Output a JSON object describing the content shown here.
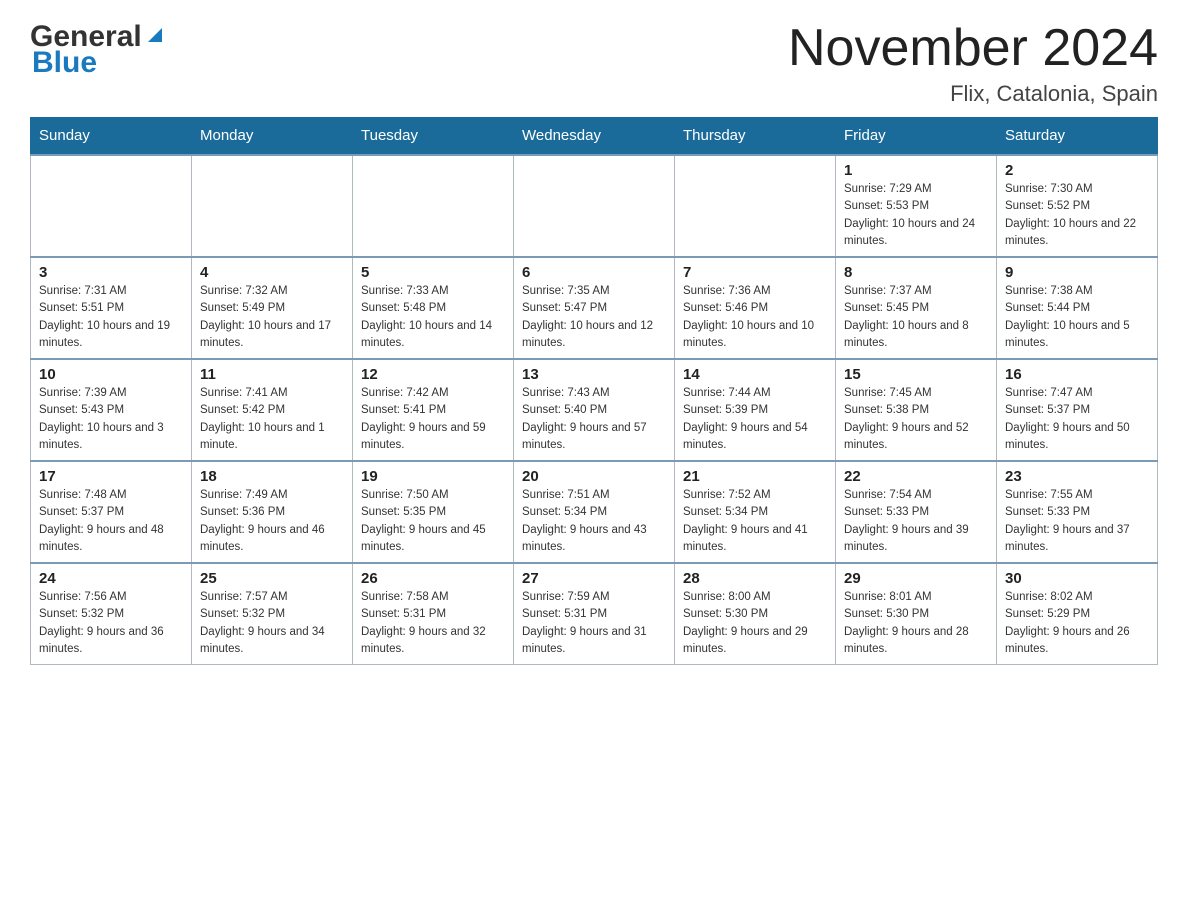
{
  "header": {
    "logo": {
      "general": "General",
      "blue": "Blue"
    },
    "title": "November 2024",
    "location": "Flix, Catalonia, Spain"
  },
  "weekdays": [
    "Sunday",
    "Monday",
    "Tuesday",
    "Wednesday",
    "Thursday",
    "Friday",
    "Saturday"
  ],
  "weeks": [
    [
      {
        "day": "",
        "info": ""
      },
      {
        "day": "",
        "info": ""
      },
      {
        "day": "",
        "info": ""
      },
      {
        "day": "",
        "info": ""
      },
      {
        "day": "",
        "info": ""
      },
      {
        "day": "1",
        "info": "Sunrise: 7:29 AM\nSunset: 5:53 PM\nDaylight: 10 hours and 24 minutes."
      },
      {
        "day": "2",
        "info": "Sunrise: 7:30 AM\nSunset: 5:52 PM\nDaylight: 10 hours and 22 minutes."
      }
    ],
    [
      {
        "day": "3",
        "info": "Sunrise: 7:31 AM\nSunset: 5:51 PM\nDaylight: 10 hours and 19 minutes."
      },
      {
        "day": "4",
        "info": "Sunrise: 7:32 AM\nSunset: 5:49 PM\nDaylight: 10 hours and 17 minutes."
      },
      {
        "day": "5",
        "info": "Sunrise: 7:33 AM\nSunset: 5:48 PM\nDaylight: 10 hours and 14 minutes."
      },
      {
        "day": "6",
        "info": "Sunrise: 7:35 AM\nSunset: 5:47 PM\nDaylight: 10 hours and 12 minutes."
      },
      {
        "day": "7",
        "info": "Sunrise: 7:36 AM\nSunset: 5:46 PM\nDaylight: 10 hours and 10 minutes."
      },
      {
        "day": "8",
        "info": "Sunrise: 7:37 AM\nSunset: 5:45 PM\nDaylight: 10 hours and 8 minutes."
      },
      {
        "day": "9",
        "info": "Sunrise: 7:38 AM\nSunset: 5:44 PM\nDaylight: 10 hours and 5 minutes."
      }
    ],
    [
      {
        "day": "10",
        "info": "Sunrise: 7:39 AM\nSunset: 5:43 PM\nDaylight: 10 hours and 3 minutes."
      },
      {
        "day": "11",
        "info": "Sunrise: 7:41 AM\nSunset: 5:42 PM\nDaylight: 10 hours and 1 minute."
      },
      {
        "day": "12",
        "info": "Sunrise: 7:42 AM\nSunset: 5:41 PM\nDaylight: 9 hours and 59 minutes."
      },
      {
        "day": "13",
        "info": "Sunrise: 7:43 AM\nSunset: 5:40 PM\nDaylight: 9 hours and 57 minutes."
      },
      {
        "day": "14",
        "info": "Sunrise: 7:44 AM\nSunset: 5:39 PM\nDaylight: 9 hours and 54 minutes."
      },
      {
        "day": "15",
        "info": "Sunrise: 7:45 AM\nSunset: 5:38 PM\nDaylight: 9 hours and 52 minutes."
      },
      {
        "day": "16",
        "info": "Sunrise: 7:47 AM\nSunset: 5:37 PM\nDaylight: 9 hours and 50 minutes."
      }
    ],
    [
      {
        "day": "17",
        "info": "Sunrise: 7:48 AM\nSunset: 5:37 PM\nDaylight: 9 hours and 48 minutes."
      },
      {
        "day": "18",
        "info": "Sunrise: 7:49 AM\nSunset: 5:36 PM\nDaylight: 9 hours and 46 minutes."
      },
      {
        "day": "19",
        "info": "Sunrise: 7:50 AM\nSunset: 5:35 PM\nDaylight: 9 hours and 45 minutes."
      },
      {
        "day": "20",
        "info": "Sunrise: 7:51 AM\nSunset: 5:34 PM\nDaylight: 9 hours and 43 minutes."
      },
      {
        "day": "21",
        "info": "Sunrise: 7:52 AM\nSunset: 5:34 PM\nDaylight: 9 hours and 41 minutes."
      },
      {
        "day": "22",
        "info": "Sunrise: 7:54 AM\nSunset: 5:33 PM\nDaylight: 9 hours and 39 minutes."
      },
      {
        "day": "23",
        "info": "Sunrise: 7:55 AM\nSunset: 5:33 PM\nDaylight: 9 hours and 37 minutes."
      }
    ],
    [
      {
        "day": "24",
        "info": "Sunrise: 7:56 AM\nSunset: 5:32 PM\nDaylight: 9 hours and 36 minutes."
      },
      {
        "day": "25",
        "info": "Sunrise: 7:57 AM\nSunset: 5:32 PM\nDaylight: 9 hours and 34 minutes."
      },
      {
        "day": "26",
        "info": "Sunrise: 7:58 AM\nSunset: 5:31 PM\nDaylight: 9 hours and 32 minutes."
      },
      {
        "day": "27",
        "info": "Sunrise: 7:59 AM\nSunset: 5:31 PM\nDaylight: 9 hours and 31 minutes."
      },
      {
        "day": "28",
        "info": "Sunrise: 8:00 AM\nSunset: 5:30 PM\nDaylight: 9 hours and 29 minutes."
      },
      {
        "day": "29",
        "info": "Sunrise: 8:01 AM\nSunset: 5:30 PM\nDaylight: 9 hours and 28 minutes."
      },
      {
        "day": "30",
        "info": "Sunrise: 8:02 AM\nSunset: 5:29 PM\nDaylight: 9 hours and 26 minutes."
      }
    ]
  ]
}
